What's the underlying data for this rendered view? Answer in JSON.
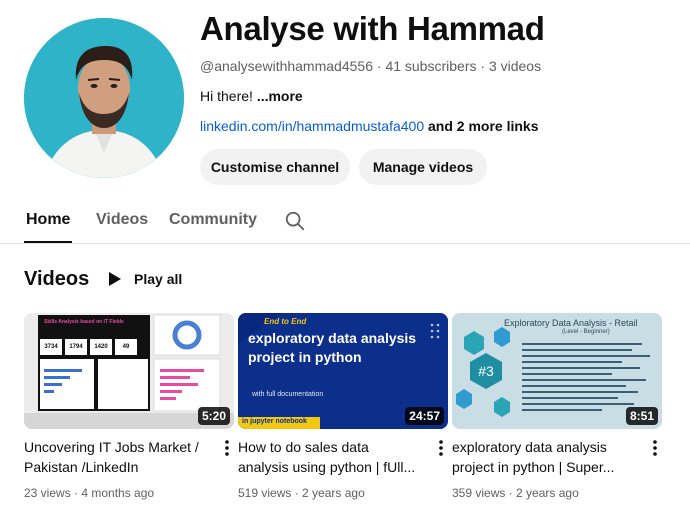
{
  "channel": {
    "name": "Analyse with Hammad",
    "handle": "@analysewithhammad4556",
    "subscribers": "41 subscribers",
    "videos_count": "3 videos",
    "separator": " · ",
    "description": "Hi there! ",
    "description_more": "...more",
    "link": "linkedin.com/in/hammadmustafa400",
    "more_links": " and 2 more links"
  },
  "buttons": {
    "customise": "Customise channel",
    "manage": "Manage videos"
  },
  "tabs": [
    {
      "label": "Home",
      "active": true
    },
    {
      "label": "Videos",
      "active": false
    },
    {
      "label": "Community",
      "active": false
    }
  ],
  "section": {
    "title": "Videos",
    "play_all": "Play all"
  },
  "videos": [
    {
      "title": "Uncovering IT Jobs Market / Pakistan /LinkedIn",
      "duration": "5:20",
      "views": "23 views",
      "age": "4 months ago",
      "thumb_text": "Skills Analysis based on IT Fields",
      "kpis": [
        "3734",
        "1794",
        "1420",
        "49"
      ]
    },
    {
      "title": "How to do sales data analysis using python | fUll...",
      "duration": "24:57",
      "views": "519 views",
      "age": "2 years ago",
      "thumb_badge": "End to End",
      "thumb_heading": "exploratory data analysis project  in python",
      "thumb_sub": "with full documentation",
      "thumb_footer": "in jupyter notebook"
    },
    {
      "title": "exploratory data analysis project in python | Super...",
      "duration": "8:51",
      "views": "359 views",
      "age": "2 years ago",
      "thumb_heading": "Exploratory Data Analysis - Retail",
      "thumb_sub": "(Level - Beginner)",
      "thumb_number": "#3"
    }
  ],
  "colors": {
    "link": "#065fd4",
    "avatar_bg": "#2fb3c9",
    "button_bg": "#f2f2f2"
  }
}
